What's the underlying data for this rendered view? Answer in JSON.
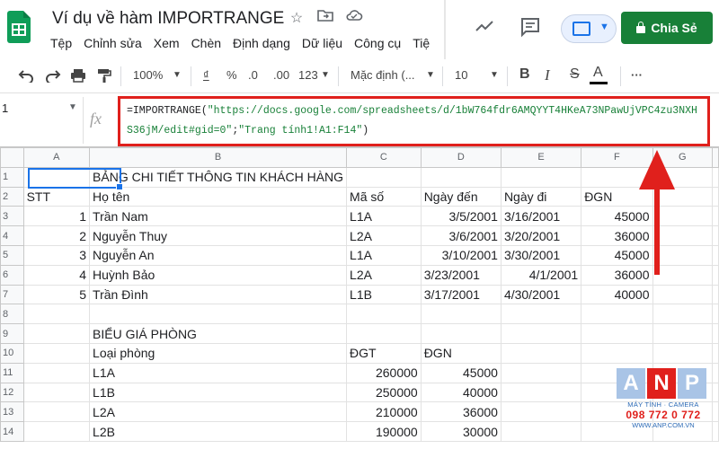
{
  "header": {
    "doc_title": "Ví dụ về hàm IMPORTRANGE",
    "title_icons": [
      "star-icon",
      "move-to-folder-icon",
      "cloud-status-icon"
    ],
    "menu": [
      "Tệp",
      "Chỉnh sửa",
      "Xem",
      "Chèn",
      "Định dạng",
      "Dữ liệu",
      "Công cụ",
      "Tiệ"
    ],
    "share_label": "Chia Sẻ",
    "share_color": "#188038"
  },
  "toolbar": {
    "zoom": "100%",
    "currency": "₫",
    "percent": "%",
    "decimal_decrease": ".0",
    "decimal_increase": ".00",
    "more_formats": "123",
    "font": "Mặc định (...",
    "font_size": "10",
    "bold": "B",
    "italic": "I",
    "strike": "S",
    "text_color": "A",
    "more": "···"
  },
  "formula_bar": {
    "name_box": "1",
    "fx": "fx",
    "formula_prefix": "=IMPORTRANGE(",
    "formula_url": "\"https://docs.google.com/spreadsheets/d/1bW764fdr6AMQYYT4HKeA73NPawUjVPC4zu3NXHS36jM/edit#gid=0\"",
    "formula_sep": ";",
    "formula_range": "\"Trang tính1!A1:F14\"",
    "formula_suffix": ")",
    "highlight_color": "#e0201c"
  },
  "sheet": {
    "columns": [
      "A",
      "B",
      "C",
      "D",
      "E",
      "F",
      "G"
    ],
    "rows": [
      {
        "n": "1",
        "cells": [
          "",
          "BẢNG CHI TIẾT THÔNG TIN KHÁCH HÀNG",
          "",
          "",
          "",
          "",
          ""
        ]
      },
      {
        "n": "2",
        "cells": [
          "STT",
          "Họ tên",
          "Mã số",
          "Ngày đến",
          "Ngày đi",
          "ĐGN",
          ""
        ]
      },
      {
        "n": "3",
        "cells": [
          "1",
          "Trần Nam",
          "L1A",
          "3/5/2001",
          "3/16/2001",
          "45000",
          ""
        ]
      },
      {
        "n": "4",
        "cells": [
          "2",
          "Nguyễn Thuy",
          "L2A",
          "3/6/2001",
          "3/20/2001",
          "36000",
          ""
        ]
      },
      {
        "n": "5",
        "cells": [
          "3",
          "Nguyễn An",
          "L1A",
          "3/10/2001",
          "3/30/2001",
          "45000",
          ""
        ]
      },
      {
        "n": "6",
        "cells": [
          "4",
          "Huỳnh Bảo",
          "L2A",
          "3/23/2001",
          "4/1/2001",
          "36000",
          ""
        ]
      },
      {
        "n": "7",
        "cells": [
          "5",
          "Trần Đình",
          "L1B",
          "3/17/2001",
          "4/30/2001",
          "40000",
          ""
        ]
      },
      {
        "n": "8",
        "cells": [
          "",
          "",
          "",
          "",
          "",
          "",
          ""
        ]
      },
      {
        "n": "9",
        "cells": [
          "",
          "BIỂU GIÁ PHÒNG",
          "",
          "",
          "",
          "",
          ""
        ]
      },
      {
        "n": "10",
        "cells": [
          "",
          "Loại phòng",
          "ĐGT",
          "ĐGN",
          "",
          "",
          ""
        ]
      },
      {
        "n": "11",
        "cells": [
          "",
          "L1A",
          "260000",
          "45000",
          "",
          "",
          ""
        ]
      },
      {
        "n": "12",
        "cells": [
          "",
          "L1B",
          "250000",
          "40000",
          "",
          "",
          ""
        ]
      },
      {
        "n": "13",
        "cells": [
          "",
          "L2A",
          "210000",
          "36000",
          "",
          "",
          ""
        ]
      },
      {
        "n": "14",
        "cells": [
          "",
          "L2B",
          "190000",
          "30000",
          "",
          "",
          ""
        ]
      }
    ]
  },
  "watermark": {
    "letters": [
      "A",
      "N",
      "P"
    ],
    "tagline": "MÁY TÍNH · CAMERA",
    "phone": "098 772 0 772",
    "website": "WWW.ANP.COM.VN"
  }
}
